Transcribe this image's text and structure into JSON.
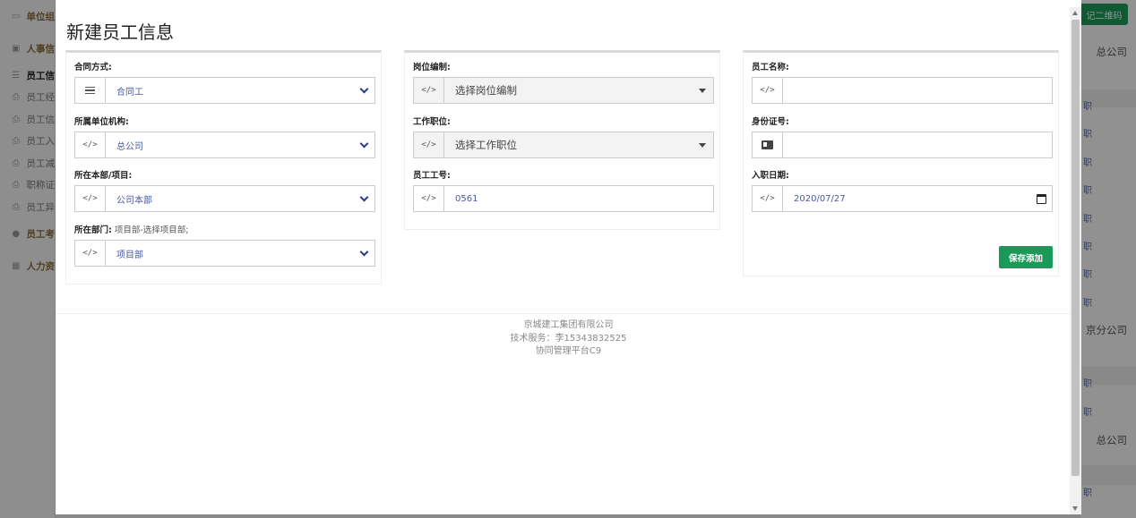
{
  "background": {
    "sidebar": [
      {
        "label": "单位组",
        "icon": "map-icon",
        "type": "section"
      },
      {
        "label": "人事信",
        "icon": "id-card-icon",
        "type": "section"
      },
      {
        "label": "员工信",
        "icon": "list-icon",
        "type": "active"
      },
      {
        "label": "员工经",
        "icon": "print-icon",
        "type": "item"
      },
      {
        "label": "员工信",
        "icon": "print-icon",
        "type": "item"
      },
      {
        "label": "员工入",
        "icon": "print-icon",
        "type": "item"
      },
      {
        "label": "员工减",
        "icon": "print-icon",
        "type": "item"
      },
      {
        "label": "职称证",
        "icon": "print-icon",
        "type": "item"
      },
      {
        "label": "员工异",
        "icon": "print-icon",
        "type": "item"
      },
      {
        "label": "员工考",
        "icon": "user-circle-icon",
        "type": "section"
      },
      {
        "label": "人力资",
        "icon": "calendar-icon",
        "type": "section"
      }
    ],
    "qr_button": "记二维码",
    "right_company_1": "总公司",
    "right_company_2": "京分公司",
    "right_company_3": "总公司",
    "right_cells": [
      "职",
      "职",
      "职",
      "职",
      "职",
      "职",
      "职",
      "职",
      "职",
      "职",
      "职"
    ]
  },
  "modal": {
    "title": "新建员工信息",
    "fields": {
      "contract_type": {
        "label": "合同方式:",
        "value": "合同工",
        "icon": "list-icon"
      },
      "unit": {
        "label": "所属单位机构:",
        "value": "总公司",
        "icon": "code-icon"
      },
      "department_project": {
        "label": "所在本部/项目:",
        "value": "公司本部",
        "icon": "code-icon"
      },
      "dept": {
        "label": "所在部门:",
        "note": "项目部-选择项目部;",
        "value": "项目部",
        "icon": "code-icon"
      },
      "post_org": {
        "label": "岗位编制:",
        "value": "选择岗位编制",
        "icon": "code-icon"
      },
      "job_title": {
        "label": "工作职位:",
        "value": "选择工作职位",
        "icon": "code-icon"
      },
      "employee_no": {
        "label": "员工工号:",
        "value": "0561",
        "icon": "code-icon"
      },
      "employee_name": {
        "label": "员工名称:",
        "value": "",
        "icon": "code-icon"
      },
      "id_number": {
        "label": "身份证号:",
        "value": "",
        "icon": "id-card-icon"
      },
      "hire_date": {
        "label": "入职日期:",
        "value": "2020/07/27",
        "icon": "code-icon"
      }
    },
    "save_label": "保存添加",
    "footer": {
      "company": "京城建工集团有限公司",
      "support": "技术服务：李15343832525",
      "platform": "协同管理平台C9"
    }
  },
  "colors": {
    "accent": "#1a9a58",
    "value_text": "#4a5aa0"
  }
}
